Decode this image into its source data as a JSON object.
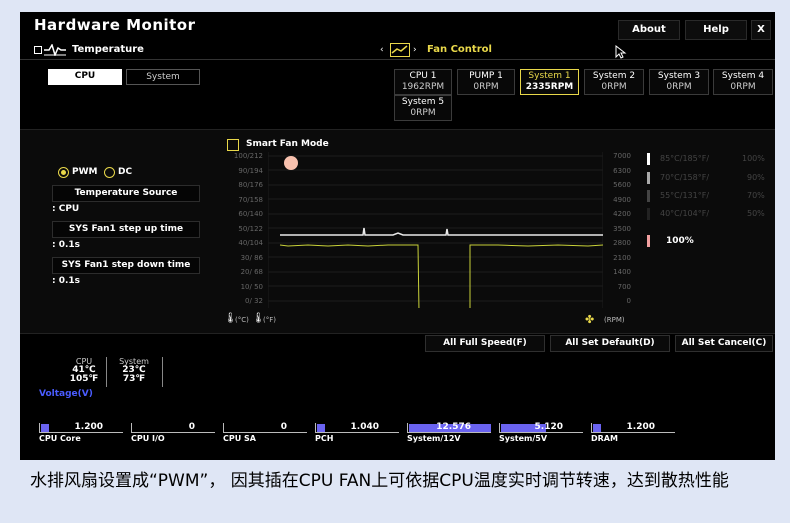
{
  "app": {
    "title": "Hardware Monitor"
  },
  "window_buttons": {
    "about": "About",
    "help": "Help",
    "close": "X"
  },
  "temperature": {
    "header": "Temperature",
    "tabs": [
      "CPU",
      "System"
    ],
    "mode_pwm": "PWM",
    "mode_dc": "DC",
    "source_label": "Temperature Source",
    "source_value": ": CPU",
    "step_up_label": "SYS Fan1 step up time",
    "step_up_value": ": 0.1s",
    "step_down_label": "SYS Fan1 step down time",
    "step_down_value": ": 0.1s"
  },
  "fan_control": {
    "header": "Fan Control",
    "fans": [
      {
        "name": "CPU 1",
        "rpm": "1962RPM"
      },
      {
        "name": "PUMP 1",
        "rpm": "0RPM"
      },
      {
        "name": "System 1",
        "rpm": "2335RPM"
      },
      {
        "name": "System 2",
        "rpm": "0RPM"
      },
      {
        "name": "System 3",
        "rpm": "0RPM"
      },
      {
        "name": "System 4",
        "rpm": "0RPM"
      },
      {
        "name": "System 5",
        "rpm": "0RPM"
      }
    ]
  },
  "chart": {
    "smart_fan_label": "Smart Fan Mode",
    "y_left": [
      "100/212",
      "90/194",
      "80/176",
      "70/158",
      "60/140",
      "50/122",
      "40/104",
      "30/ 86",
      "20/ 68",
      "10/ 50",
      "0/ 32"
    ],
    "y_right": [
      "7000",
      "6300",
      "5600",
      "4900",
      "4200",
      "3500",
      "2800",
      "2100",
      "1400",
      "700",
      "0"
    ],
    "unit_c": "(°C)",
    "unit_f": "(°F)",
    "unit_rpm": "(RPM)",
    "levels": [
      {
        "label": "85°C/185°F/",
        "pct": "100%"
      },
      {
        "label": "70°C/158°F/",
        "pct": "90%"
      },
      {
        "label": "55°C/131°F/",
        "pct": "70%"
      },
      {
        "label": "40°C/104°F/",
        "pct": "50%"
      }
    ],
    "current_pct": "100%"
  },
  "actions": {
    "full_speed": "All Full Speed(F)",
    "set_default": "All Set Default(D)",
    "set_cancel": "All Set Cancel(C)"
  },
  "temps": {
    "cpu_label": "CPU",
    "cpu_c": "41℃",
    "cpu_f": "105℉",
    "sys_label": "System",
    "sys_c": "23℃",
    "sys_f": "73℉"
  },
  "voltage": {
    "title": "Voltage(V)",
    "items": [
      {
        "label": "CPU Core",
        "value": "1.200",
        "fill": 0.1
      },
      {
        "label": "CPU I/O",
        "value": "0",
        "fill": 0
      },
      {
        "label": "CPU SA",
        "value": "0",
        "fill": 0
      },
      {
        "label": "PCH",
        "value": "1.040",
        "fill": 0.1
      },
      {
        "label": "System/12V",
        "value": "12.576",
        "fill": 1.0
      },
      {
        "label": "System/5V",
        "value": "5.120",
        "fill": 0.55
      },
      {
        "label": "DRAM",
        "value": "1.200",
        "fill": 0.1
      }
    ]
  },
  "caption": "水排风扇设置成“PWM”， 因其插在CPU FAN上可依据CPU温度实时调节转速，达到散热性能",
  "colors": {
    "accent": "#e9d84a",
    "voltage_bar": "#6a63f0",
    "voltage_title": "#4a5cff",
    "highlight": "#f2a0a0"
  }
}
